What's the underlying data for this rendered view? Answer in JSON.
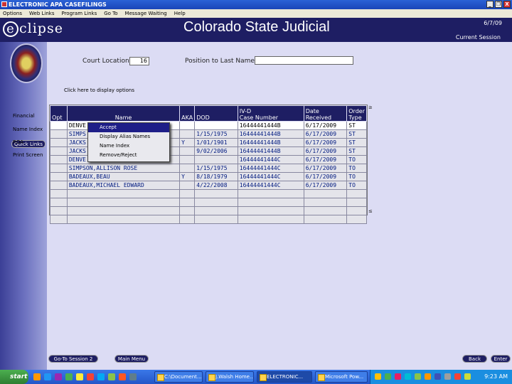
{
  "window": {
    "title": "ELECTRONIC APA CASEFILINGS",
    "buttons": {
      "minimize": "_",
      "restore": "❐",
      "close": "X"
    }
  },
  "menubar": [
    "Options",
    "Web Links",
    "Program Links",
    "Go To",
    "Message Waiting",
    "Help"
  ],
  "header": {
    "logo_letter": "e",
    "logo_text": "clipse",
    "title": "Colorado State Judicial",
    "date": "6/7/09",
    "session": "Current Session"
  },
  "sidebar": {
    "quick_links": "Quick Links",
    "links": [
      "Financial",
      "Name Index",
      "ROA",
      "Print Screen"
    ]
  },
  "form": {
    "court_location_label": "Court Location:",
    "court_location_value": "16",
    "position_label": "Position to Last Name:",
    "position_value": "",
    "display_options_link": "Click here to display options"
  },
  "table": {
    "headers": [
      "Opt",
      "Name",
      "AKA",
      "DOD",
      "IV-D\nCase Number",
      "Date\nReceived",
      "Order\nType"
    ],
    "rows": [
      {
        "opt": "",
        "name": "DENVE",
        "aka": "",
        "dod": "",
        "case": "16444441444B",
        "date": "6/17/2009",
        "type": "ST"
      },
      {
        "opt": "",
        "name": "SIMPS",
        "aka": "",
        "dod": "1/15/1975",
        "case": "16444441444B",
        "date": "6/17/2009",
        "type": "ST"
      },
      {
        "opt": "",
        "name": "JACKS",
        "aka": "Y",
        "dod": "1/01/1901",
        "case": "16444441444B",
        "date": "6/17/2009",
        "type": "ST"
      },
      {
        "opt": "",
        "name": "JACKS",
        "aka": "",
        "dod": "9/02/2006",
        "case": "16444441444B",
        "date": "6/17/2009",
        "type": "ST"
      },
      {
        "opt": "",
        "name": "DENVE",
        "aka": "",
        "dod": "",
        "case": "16444441444C",
        "date": "6/17/2009",
        "type": "TO"
      },
      {
        "opt": "",
        "name": "SIMPSON,ALLISON ROSE",
        "aka": "",
        "dod": "1/15/1975",
        "case": "16444441444C",
        "date": "6/17/2009",
        "type": "TO"
      },
      {
        "opt": "",
        "name": "BADEAUX,BEAU",
        "aka": "Y",
        "dod": "8/18/1979",
        "case": "16444441444C",
        "date": "6/17/2009",
        "type": "TO"
      },
      {
        "opt": "",
        "name": "BADEAUX,MICHAEL EDWARD",
        "aka": "",
        "dod": "4/22/2008",
        "case": "16444441444C",
        "date": "6/17/2009",
        "type": "TO"
      }
    ],
    "empty_rows": 4,
    "scroll_top": "≥",
    "scroll_bottom": "≤"
  },
  "context_menu": [
    "Accept",
    "Display Alias Names",
    "Name Index",
    "Remove/Reject"
  ],
  "bottom_buttons": {
    "goto_session": "Go-To Session 2",
    "main_menu": "Main Menu",
    "back": "Back",
    "enter": "Enter"
  },
  "taskbar": {
    "start": "start",
    "tasks": [
      "C:\\Document...",
      "J.Walsh Home...",
      "ELECTRONIC...",
      "Microsoft Pow..."
    ],
    "clock": "9:23 AM"
  }
}
